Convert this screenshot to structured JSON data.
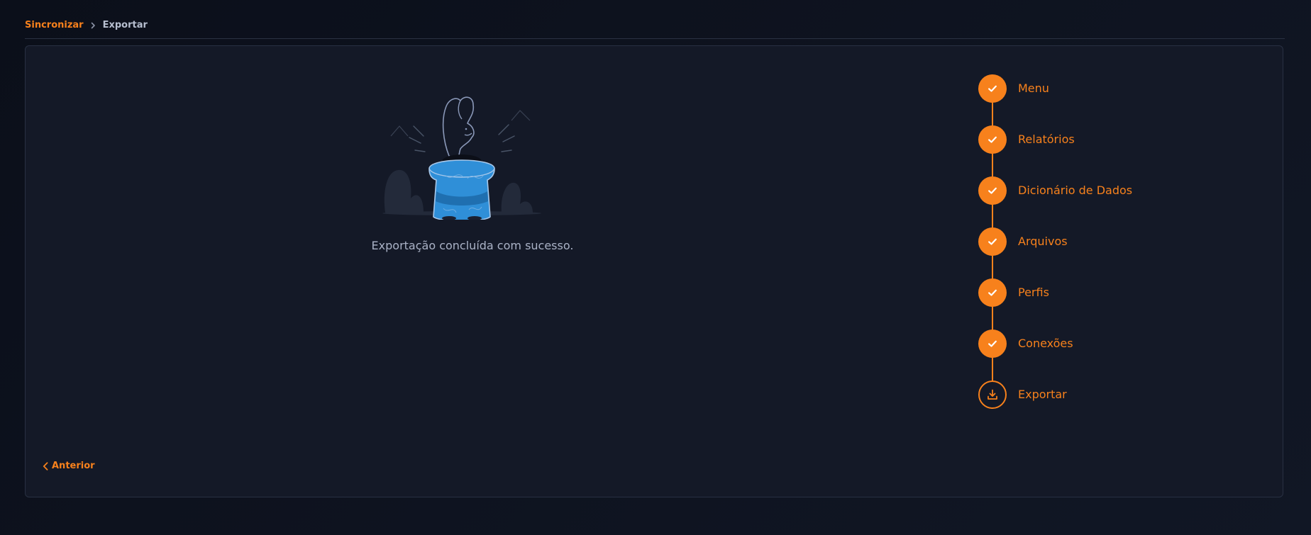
{
  "breadcrumb": {
    "root": "Sincronizar",
    "current": "Exportar"
  },
  "main": {
    "message": "Exportação concluída com sucesso."
  },
  "steps": [
    {
      "label": "Menu",
      "icon": "check-icon",
      "status": "done"
    },
    {
      "label": "Relatórios",
      "icon": "check-icon",
      "status": "done"
    },
    {
      "label": "Dicionário de Dados",
      "icon": "check-icon",
      "status": "done"
    },
    {
      "label": "Arquivos",
      "icon": "check-icon",
      "status": "done"
    },
    {
      "label": "Perfis",
      "icon": "check-icon",
      "status": "done"
    },
    {
      "label": "Conexões",
      "icon": "check-icon",
      "status": "done"
    },
    {
      "label": "Exportar",
      "icon": "download-icon",
      "status": "current"
    }
  ],
  "footer": {
    "prev_label": "Anterior"
  },
  "colors": {
    "accent": "#f7811c",
    "background": "#0f1320",
    "card": "#141927",
    "text_muted": "#aab2c6",
    "illustration_blue": "#2f8fd8"
  }
}
